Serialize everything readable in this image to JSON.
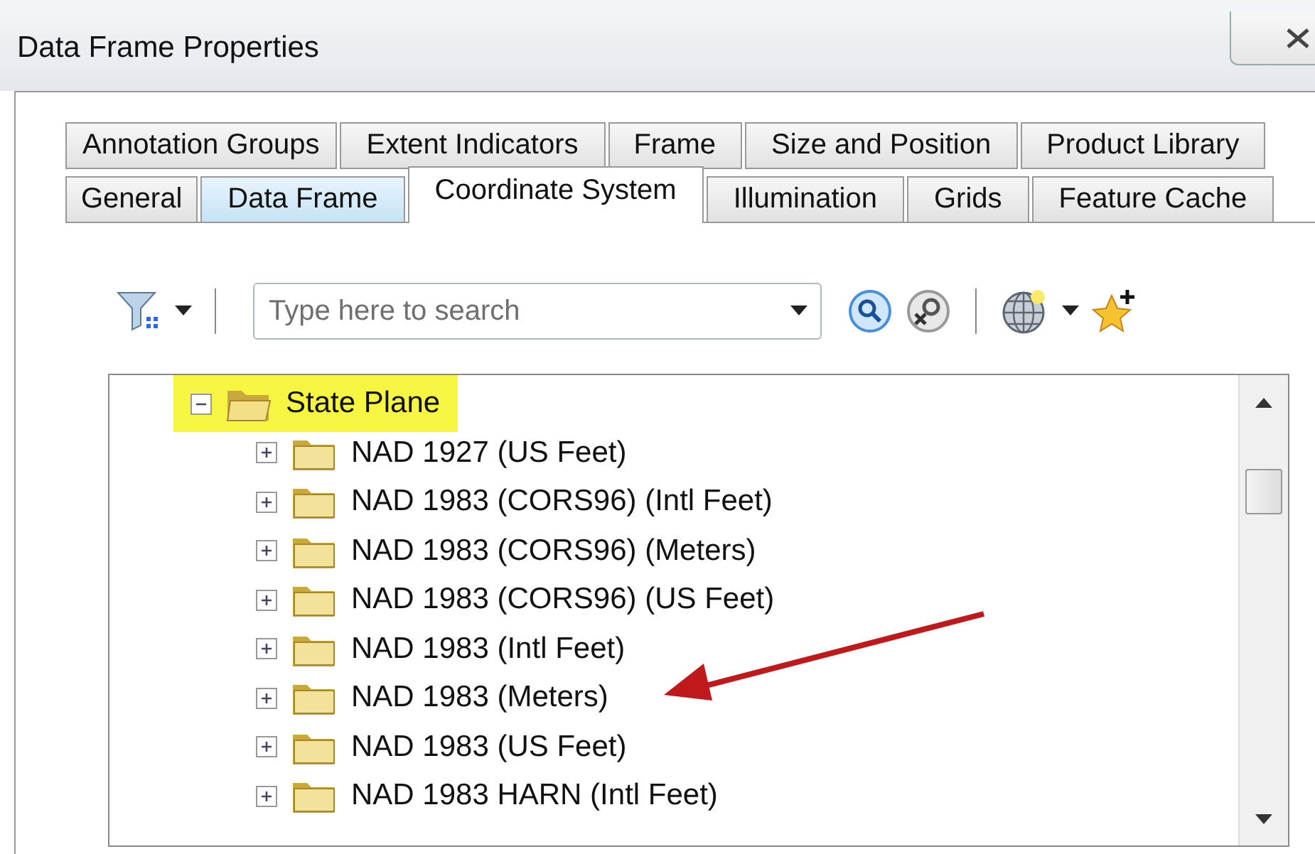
{
  "window": {
    "title": "Data Frame Properties"
  },
  "tab_rows": [
    [
      {
        "label": "Annotation Groups",
        "selected": false,
        "hovered": false
      },
      {
        "label": "Extent Indicators",
        "selected": false,
        "hovered": false
      },
      {
        "label": "Frame",
        "selected": false,
        "hovered": false
      },
      {
        "label": "Size and Position",
        "selected": false,
        "hovered": false
      },
      {
        "label": "Product Library",
        "selected": false,
        "hovered": false
      }
    ],
    [
      {
        "label": "General",
        "selected": false,
        "hovered": false
      },
      {
        "label": "Data Frame",
        "selected": false,
        "hovered": true
      },
      {
        "label": "Coordinate System",
        "selected": true,
        "hovered": false
      },
      {
        "label": "Illumination",
        "selected": false,
        "hovered": false
      },
      {
        "label": "Grids",
        "selected": false,
        "hovered": false
      },
      {
        "label": "Feature Cache",
        "selected": false,
        "hovered": false
      }
    ]
  ],
  "search": {
    "placeholder": "Type here to search"
  },
  "tree": [
    {
      "label": "State Plane",
      "expanded": true,
      "highlighted": true,
      "children": [
        {
          "label": "NAD 1927 (US Feet)",
          "expanded": false,
          "highlighted": false
        },
        {
          "label": "NAD 1983 (CORS96) (Intl Feet)",
          "expanded": false,
          "highlighted": false
        },
        {
          "label": "NAD 1983 (CORS96) (Meters)",
          "expanded": false,
          "highlighted": false
        },
        {
          "label": "NAD 1983 (CORS96) (US Feet)",
          "expanded": false,
          "highlighted": false
        },
        {
          "label": "NAD 1983 (Intl Feet)",
          "expanded": false,
          "highlighted": false
        },
        {
          "label": "NAD 1983 (Meters)",
          "expanded": false,
          "highlighted": false,
          "pointed": true
        },
        {
          "label": "NAD 1983 (US Feet)",
          "expanded": false,
          "highlighted": false
        },
        {
          "label": "NAD 1983 HARN (Intl Feet)",
          "expanded": false,
          "highlighted": false
        }
      ]
    }
  ]
}
